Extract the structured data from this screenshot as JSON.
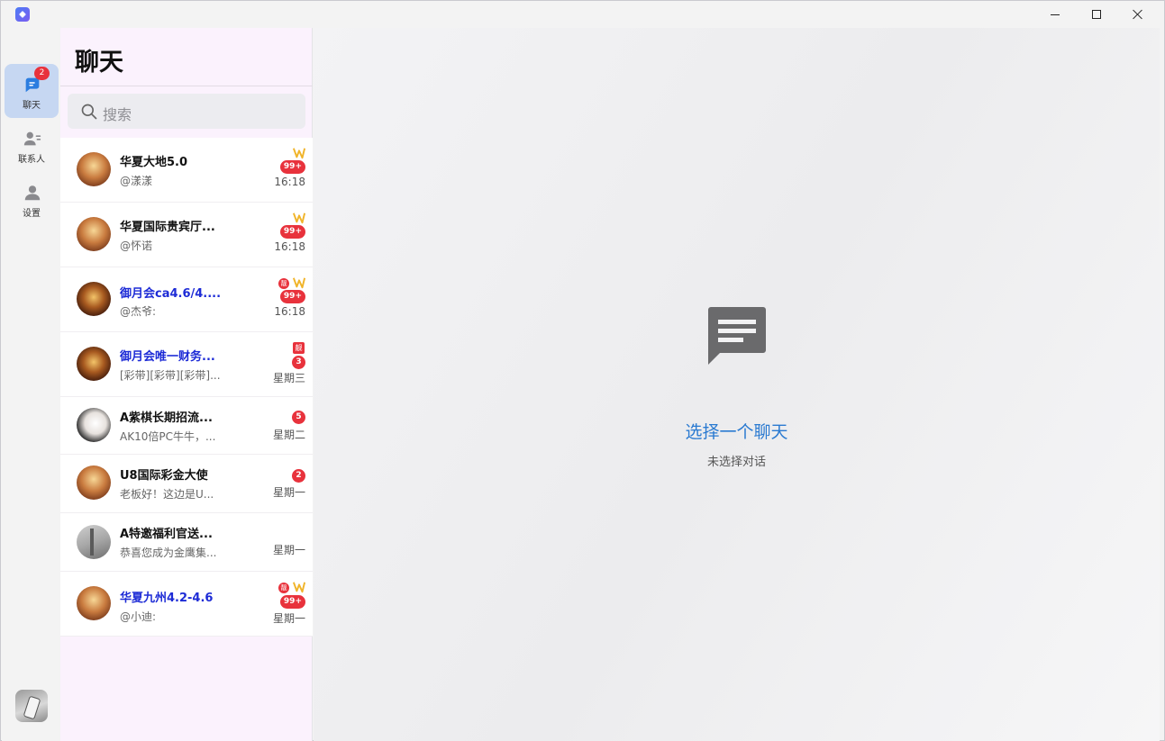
{
  "window": {
    "controls": {
      "minimize": "minimize-icon",
      "maximize": "maximize-icon",
      "close": "close-icon"
    }
  },
  "rail": {
    "items": [
      {
        "label": "聊天",
        "icon": "chat-icon",
        "badge": "2",
        "active": true
      },
      {
        "label": "联系人",
        "icon": "contacts-icon"
      },
      {
        "label": "设置",
        "icon": "settings-icon"
      }
    ]
  },
  "chat_list": {
    "title": "聊天",
    "search_placeholder": "搜索",
    "conversations": [
      {
        "name": "华夏大地5.0",
        "preview": "@漾漾",
        "time": "16:18",
        "badge": "99+",
        "vip": true
      },
      {
        "name": "华夏国际贵宾厅...",
        "preview": "@怀诺",
        "time": "16:18",
        "badge": "99+",
        "vip": true
      },
      {
        "name": "御月会ca4.6/4....",
        "preview": "@杰爷:",
        "time": "16:18",
        "badge": "99+",
        "vip": true,
        "tag": "靓"
      },
      {
        "name": "御月会唯一财务...",
        "preview": "[彩带][彩带][彩带]...",
        "time": "星期三",
        "badge": "3",
        "tag": "靓"
      },
      {
        "name": "A紫棋长期招流...",
        "preview": "AK10倍PC牛牛，...",
        "time": "星期二",
        "badge": "5"
      },
      {
        "name": "U8国际彩金大使",
        "preview": "老板好！这边是U...",
        "time": "星期一",
        "badge": "2"
      },
      {
        "name": "A特邀福利官送...",
        "preview": "恭喜您成为金鹰集...",
        "time": "星期一"
      },
      {
        "name": "华夏九州4.2-4.6",
        "preview": "@小迪:",
        "time": "星期一",
        "badge": "99+",
        "vip": true,
        "tag": "靓"
      }
    ]
  },
  "main": {
    "icon": "message-icon",
    "title": "选择一个聊天",
    "subtitle": "未选择对话"
  },
  "colors": {
    "accent": "#2a7ad1",
    "badge": "#e8323c",
    "rail_active": "#c6d7f2",
    "list_bg": "#fbf2fd",
    "group_name": "#1d2bd6"
  }
}
